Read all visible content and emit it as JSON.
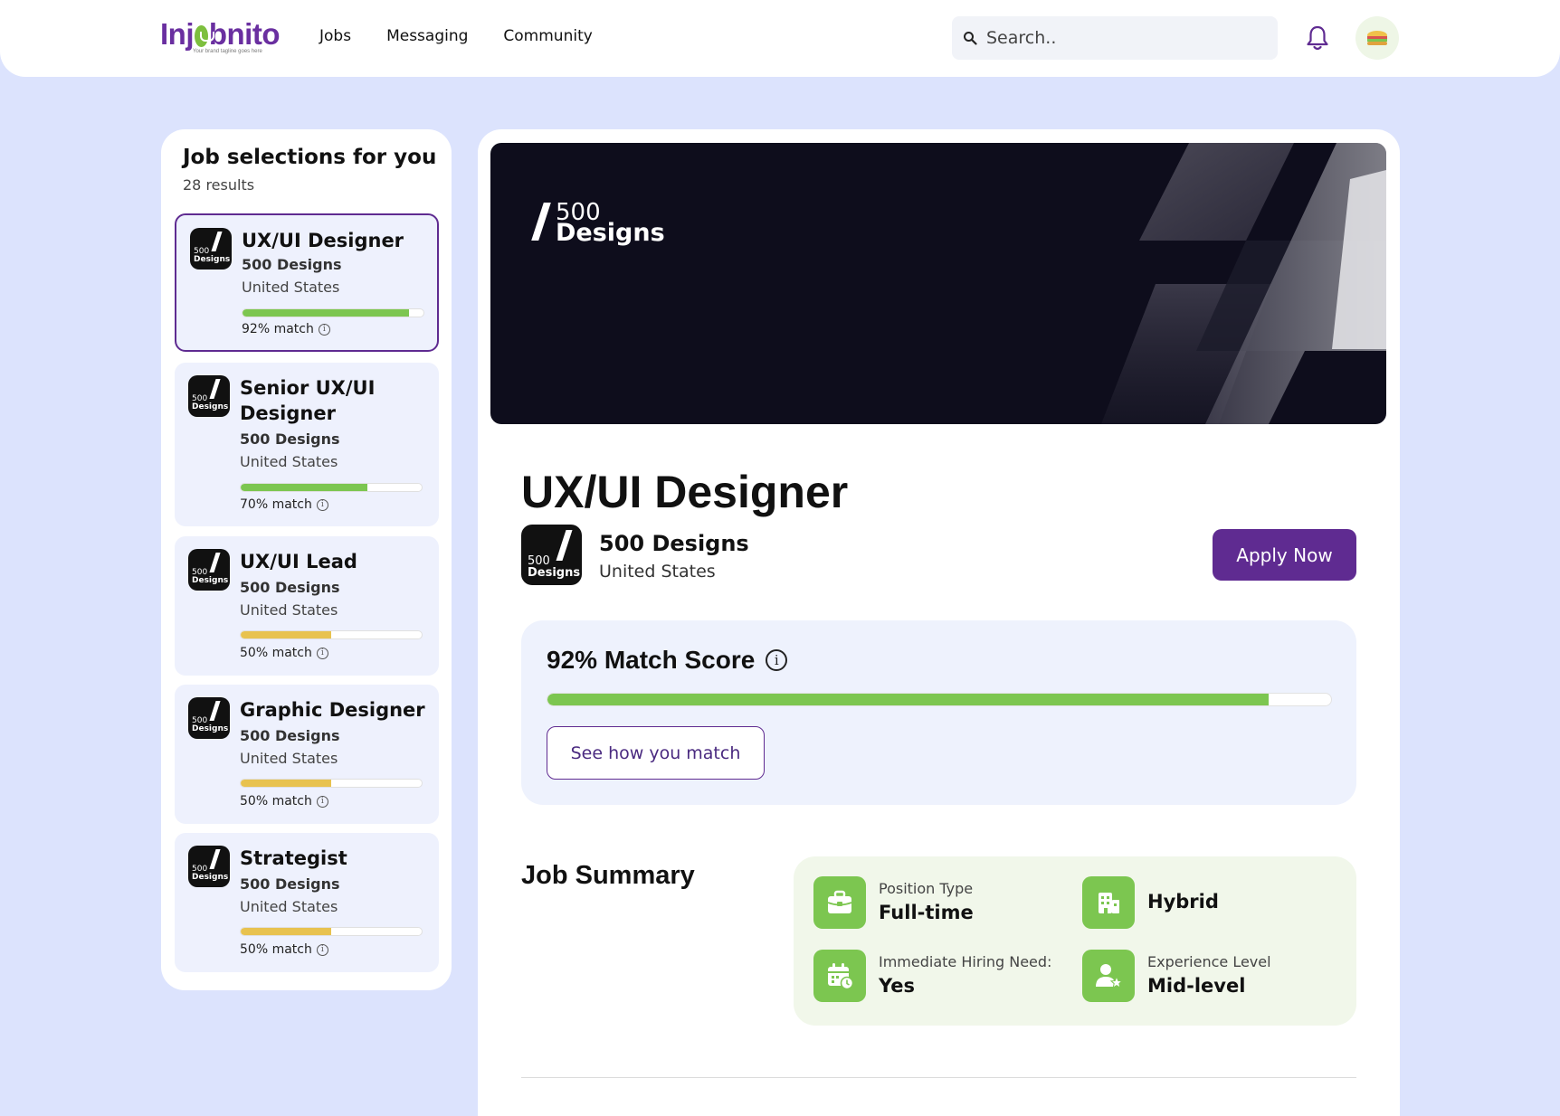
{
  "header": {
    "logo_text_pre": "Inj",
    "logo_text_post": "bnito",
    "logo_tagline": "Your brand tagline goes here",
    "nav": [
      "Jobs",
      "Messaging",
      "Community"
    ],
    "search_placeholder": "Search.."
  },
  "sidebar": {
    "title": "Job selections for you",
    "count": "28 results",
    "jobs": [
      {
        "title": "UX/UI Designer",
        "company": "500 Designs",
        "location": "United States",
        "match_label": "92% match",
        "match": 92,
        "color": "#7cc650"
      },
      {
        "title": "Senior UX/UI Designer",
        "company": "500 Designs",
        "location": "United States",
        "match_label": "70% match",
        "match": 70,
        "color": "#7cc650"
      },
      {
        "title": "UX/UI Lead",
        "company": "500 Designs",
        "location": "United States",
        "match_label": "50% match",
        "match": 50,
        "color": "#e8c24f"
      },
      {
        "title": "Graphic Designer",
        "company": "500 Designs",
        "location": "United States",
        "match_label": "50% match",
        "match": 50,
        "color": "#e8c24f"
      },
      {
        "title": "Strategist",
        "company": "500 Designs",
        "location": "United States",
        "match_label": "50% match",
        "match": 50,
        "color": "#e8c24f"
      }
    ]
  },
  "logo_mark": {
    "num": "500",
    "word": "Designs"
  },
  "detail": {
    "title": "UX/UI Designer",
    "company": "500 Designs",
    "location": "United States",
    "apply_label": "Apply Now",
    "match_title": "92% Match Score",
    "match": 92,
    "see_match_label": "See how you match",
    "summary_title": "Job Summary",
    "summary": {
      "position_label": "Position Type",
      "position_value": "Full-time",
      "work_value": "Hybrid",
      "hiring_label": "Immediate Hiring Need:",
      "hiring_value": "Yes",
      "experience_label": "Experience Level",
      "experience_value": "Mid-level"
    }
  },
  "colors": {
    "brand": "#5f2b91",
    "accent_green": "#7cc650",
    "accent_yellow": "#e8c24f"
  }
}
